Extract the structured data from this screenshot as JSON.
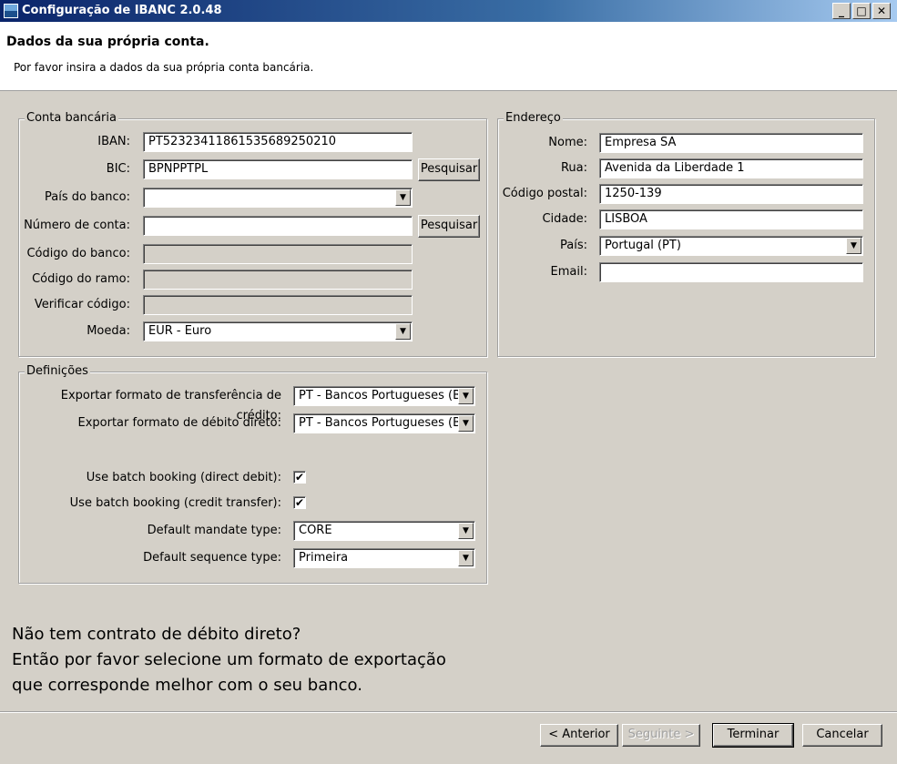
{
  "window": {
    "title": "Configuração de IBANC 2.0.48",
    "min": "_",
    "max": "□",
    "close": "✕"
  },
  "header": {
    "title": "Dados da sua própria conta.",
    "subtitle": "Por favor insira a dados da sua própria conta bancária."
  },
  "bank": {
    "legend": "Conta bancária",
    "iban_label": "IBAN:",
    "iban_value": "PT52323411861535689250210",
    "bic_label": "BIC:",
    "bic_value": "BPNPPTPL",
    "bic_search": "Pesquisar",
    "country_label": "País do banco:",
    "country_value": "",
    "account_label": "Número de conta:",
    "account_value": "",
    "account_search": "Pesquisar",
    "bankcode_label": "Código do banco:",
    "branch_label": "Código do ramo:",
    "check_label": "Verificar código:",
    "currency_label": "Moeda:",
    "currency_value": "EUR - Euro"
  },
  "address": {
    "legend": "Endereço",
    "name_label": "Nome:",
    "name_value": "Empresa SA",
    "street_label": "Rua:",
    "street_value": "Avenida da Liberdade 1",
    "zip_label": "Código postal:",
    "zip_value": "1250-139",
    "city_label": "Cidade:",
    "city_value": "LISBOA",
    "country_label": "País:",
    "country_value": "Portugal (PT)",
    "email_label": "Email:",
    "email_value": ""
  },
  "settings": {
    "legend": "Definições",
    "credit_label": "Exportar formato de transferência de crédito:",
    "credit_value": "PT - Bancos Portugueses (Bc",
    "debit_label": "Exportar formato de débito direto:",
    "debit_value": "PT - Bancos Portugueses (Bc",
    "batch_dd_label": "Use batch booking (direct debit):",
    "batch_dd_checked": true,
    "batch_ct_label": "Use batch booking (credit transfer):",
    "batch_ct_checked": true,
    "mandate_label": "Default mandate type:",
    "mandate_value": "CORE",
    "sequence_label": "Default sequence type:",
    "sequence_value": "Primeira"
  },
  "info": {
    "line1": "Não tem contrato de débito direto?",
    "line2": "Então por favor selecione um formato de exportação",
    "line3": "que corresponde melhor com o seu banco."
  },
  "footer": {
    "back": "< Anterior",
    "next": "Seguinte >",
    "finish": "Terminar",
    "cancel": "Cancelar"
  },
  "icons": {
    "dropdown": "▼",
    "check": "✔"
  }
}
